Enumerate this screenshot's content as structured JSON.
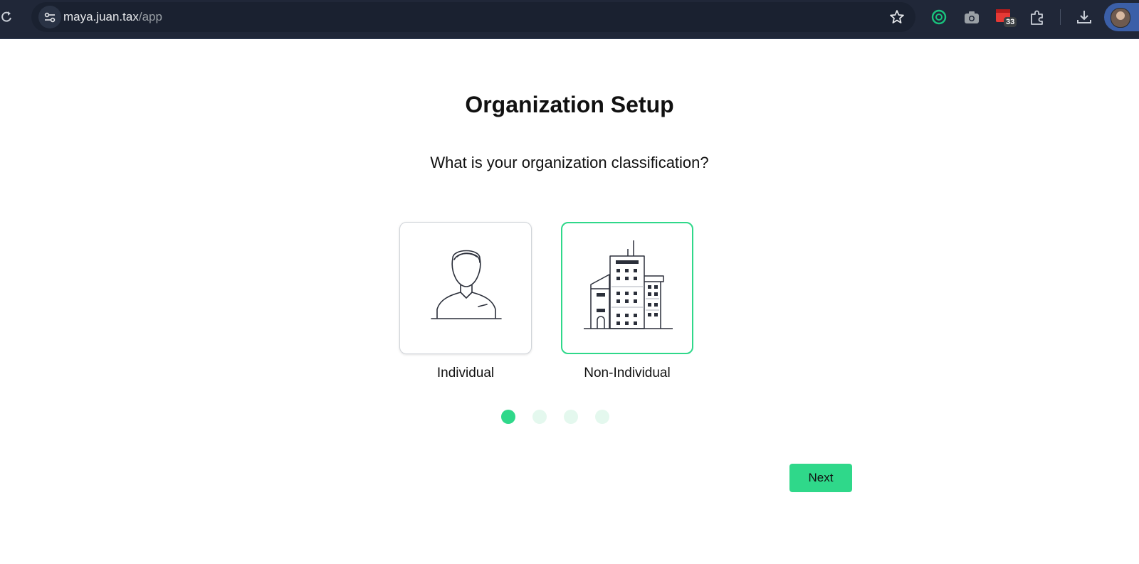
{
  "browser": {
    "url_host": "maya.juan.tax",
    "url_path": "/app",
    "extensions": [
      {
        "name": "chatgpt-extension-icon",
        "color": "#19c37d"
      },
      {
        "name": "camera-extension-icon",
        "color": "#9aa0a6"
      },
      {
        "name": "calendar-extension-icon",
        "color": "#e53935",
        "badge": "33"
      },
      {
        "name": "puzzle-extensions-icon",
        "color": "#c8cdd6"
      },
      {
        "name": "download-icon",
        "color": "#c8cdd6"
      }
    ]
  },
  "page": {
    "title": "Organization Setup",
    "question": "What is your organization classification?",
    "options": [
      {
        "label": "Individual",
        "icon": "person-icon",
        "selected": false
      },
      {
        "label": "Non-Individual",
        "icon": "building-icon",
        "selected": true
      }
    ],
    "steps": {
      "total": 4,
      "current": 1
    },
    "next_label": "Next"
  },
  "colors": {
    "accent": "#2fd88a",
    "accent_light": "#e4f8ee",
    "browser_bar": "#202738"
  }
}
